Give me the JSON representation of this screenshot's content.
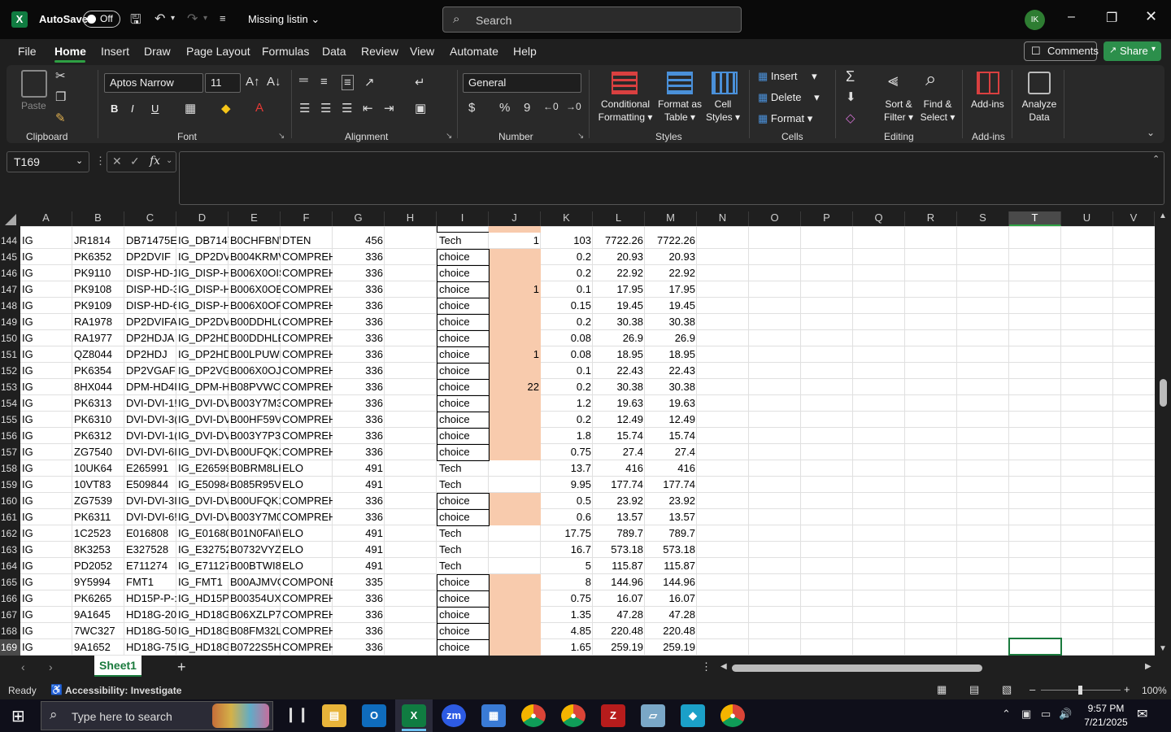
{
  "titlebar": {
    "app_logo": "X",
    "autosave_label": "AutoSave",
    "autosave_state": "Off",
    "document_title": "Missing listin",
    "search_placeholder": "Search",
    "avatar_initials": "IK"
  },
  "menu": [
    "File",
    "Home",
    "Insert",
    "Draw",
    "Page Layout",
    "Formulas",
    "Data",
    "Review",
    "View",
    "Automate",
    "Help"
  ],
  "menu_active": "Home",
  "comments_label": "Comments",
  "share_label": "Share",
  "ribbon": {
    "clipboard": {
      "paste": "Paste",
      "label": "Clipboard"
    },
    "font": {
      "name": "Aptos Narrow",
      "size": "11",
      "label": "Font",
      "bold": "B",
      "italic": "I",
      "underline": "U"
    },
    "alignment": {
      "label": "Alignment"
    },
    "number": {
      "format": "General",
      "label": "Number",
      "currency": "$",
      "percent": "%",
      "comma": "9"
    },
    "styles": {
      "conditional": "Conditional",
      "formatting": "Formatting",
      "format_as": "Format as",
      "table": "Table",
      "cell": "Cell",
      "cell_styles": "Styles",
      "label": "Styles"
    },
    "cells": {
      "insert": "Insert",
      "delete": "Delete",
      "format": "Format",
      "label": "Cells"
    },
    "editing": {
      "sort": "Sort &",
      "filter": "Filter",
      "find": "Find &",
      "select": "Select",
      "label": "Editing"
    },
    "addins": {
      "addins": "Add-ins",
      "label": "Add-ins"
    },
    "analyze": {
      "line1": "Analyze",
      "line2": "Data"
    }
  },
  "formula_bar": {
    "name_box": "T169",
    "fx": "fx",
    "content": ""
  },
  "columns": [
    "A",
    "B",
    "C",
    "D",
    "E",
    "F",
    "G",
    "H",
    "I",
    "J",
    "K",
    "L",
    "M",
    "N",
    "O",
    "P",
    "Q",
    "R",
    "S",
    "T",
    "U",
    "V"
  ],
  "active_column": "T",
  "rows": [
    {
      "n": "144",
      "a": "IG",
      "b": "JR1814",
      "c": "DB71475E",
      "d": "IG_DB7147",
      "e": "B0CHFBN\\",
      "f": "DTEN",
      "g": "456",
      "i": "Tech",
      "j": "1",
      "k": "103",
      "l": "7722.26",
      "m": "7722.26",
      "hl": false
    },
    {
      "n": "145",
      "a": "IG",
      "b": "PK6352",
      "c": "DP2DVIF",
      "d": "IG_DP2DV",
      "e": "B004KRMV",
      "f": "COMPREH",
      "g": "336",
      "i": "choice",
      "j": "",
      "k": "0.2",
      "l": "20.93",
      "m": "20.93",
      "hl": true
    },
    {
      "n": "146",
      "a": "IG",
      "b": "PK9110",
      "c": "DISP-HD-1",
      "d": "IG_DISP-H",
      "e": "B006X0OIS",
      "f": "COMPREH",
      "g": "336",
      "i": "choice",
      "j": "",
      "k": "0.2",
      "l": "22.92",
      "m": "22.92",
      "hl": true
    },
    {
      "n": "147",
      "a": "IG",
      "b": "PK9108",
      "c": "DISP-HD-3",
      "d": "IG_DISP-H",
      "e": "B006X0OB",
      "f": "COMPREH",
      "g": "336",
      "i": "choice",
      "j": "1",
      "k": "0.1",
      "l": "17.95",
      "m": "17.95",
      "hl": true
    },
    {
      "n": "148",
      "a": "IG",
      "b": "PK9109",
      "c": "DISP-HD-6",
      "d": "IG_DISP-H",
      "e": "B006X0OF",
      "f": "COMPREH",
      "g": "336",
      "i": "choice",
      "j": "",
      "k": "0.15",
      "l": "19.45",
      "m": "19.45",
      "hl": true
    },
    {
      "n": "149",
      "a": "IG",
      "b": "RA1978",
      "c": "DP2DVIFA",
      "d": "IG_DP2DV",
      "e": "B00DDHLC",
      "f": "COMPREH",
      "g": "336",
      "i": "choice",
      "j": "",
      "k": "0.2",
      "l": "30.38",
      "m": "30.38",
      "hl": true
    },
    {
      "n": "150",
      "a": "IG",
      "b": "RA1977",
      "c": "DP2HDJA",
      "d": "IG_DP2HD",
      "e": "B00DDHLE",
      "f": "COMPREH",
      "g": "336",
      "i": "choice",
      "j": "",
      "k": "0.08",
      "l": "26.9",
      "m": "26.9",
      "hl": true
    },
    {
      "n": "151",
      "a": "IG",
      "b": "QZ8044",
      "c": "DP2HDJ",
      "d": "IG_DP2HD",
      "e": "B00LPUWE",
      "f": "COMPREH",
      "g": "336",
      "i": "choice",
      "j": "1",
      "k": "0.08",
      "l": "18.95",
      "m": "18.95",
      "hl": true
    },
    {
      "n": "152",
      "a": "IG",
      "b": "PK6354",
      "c": "DP2VGAF",
      "d": "IG_DP2VG.",
      "e": "B006X0OJ'",
      "f": "COMPREH",
      "g": "336",
      "i": "choice",
      "j": "",
      "k": "0.1",
      "l": "22.43",
      "m": "22.43",
      "hl": true
    },
    {
      "n": "153",
      "a": "IG",
      "b": "8HX044",
      "c": "DPM-HD4I",
      "d": "IG_DPM-H",
      "e": "B08PVWCI",
      "f": "COMPREH",
      "g": "336",
      "i": "choice",
      "j": "22",
      "k": "0.2",
      "l": "30.38",
      "m": "30.38",
      "hl": true
    },
    {
      "n": "154",
      "a": "IG",
      "b": "PK6313",
      "c": "DVI-DVI-1!",
      "d": "IG_DVI-DV",
      "e": "B003Y7M3",
      "f": "COMPREH",
      "g": "336",
      "i": "choice",
      "j": "",
      "k": "1.2",
      "l": "19.63",
      "m": "19.63",
      "hl": true
    },
    {
      "n": "155",
      "a": "IG",
      "b": "PK6310",
      "c": "DVI-DVI-3(",
      "d": "IG_DVI-DV",
      "e": "B00HF59V",
      "f": "COMPREH",
      "g": "336",
      "i": "choice",
      "j": "",
      "k": "0.2",
      "l": "12.49",
      "m": "12.49",
      "hl": true
    },
    {
      "n": "156",
      "a": "IG",
      "b": "PK6312",
      "c": "DVI-DVI-1(",
      "d": "IG_DVI-DV",
      "e": "B003Y7P3I",
      "f": "COMPREH",
      "g": "336",
      "i": "choice",
      "j": "",
      "k": "1.8",
      "l": "15.74",
      "m": "15.74",
      "hl": true
    },
    {
      "n": "157",
      "a": "IG",
      "b": "ZG7540",
      "c": "DVI-DVI-6I",
      "d": "IG_DVI-DV",
      "e": "B00UFQK1",
      "f": "COMPREH",
      "g": "336",
      "i": "choice",
      "j": "",
      "k": "0.75",
      "l": "27.4",
      "m": "27.4",
      "hl": true
    },
    {
      "n": "158",
      "a": "IG",
      "b": "10UK64",
      "c": "E265991",
      "d": "IG_E26599",
      "e": "B0BRM8LK",
      "f": "ELO",
      "g": "491",
      "i": "Tech",
      "j": "",
      "k": "13.7",
      "l": "416",
      "m": "416",
      "hl": false
    },
    {
      "n": "159",
      "a": "IG",
      "b": "10VT83",
      "c": "E509844",
      "d": "IG_E50984",
      "e": "B085R95V.",
      "f": "ELO",
      "g": "491",
      "i": "Tech",
      "j": "",
      "k": "9.95",
      "l": "177.74",
      "m": "177.74",
      "hl": false
    },
    {
      "n": "160",
      "a": "IG",
      "b": "ZG7539",
      "c": "DVI-DVI-3I",
      "d": "IG_DVI-DV",
      "e": "B00UFQK1",
      "f": "COMPREH",
      "g": "336",
      "i": "choice",
      "j": "",
      "k": "0.5",
      "l": "23.92",
      "m": "23.92",
      "hl": true
    },
    {
      "n": "161",
      "a": "IG",
      "b": "PK6311",
      "c": "DVI-DVI-6!",
      "d": "IG_DVI-DV",
      "e": "B003Y7M0",
      "f": "COMPREH",
      "g": "336",
      "i": "choice",
      "j": "",
      "k": "0.6",
      "l": "13.57",
      "m": "13.57",
      "hl": true
    },
    {
      "n": "162",
      "a": "IG",
      "b": "1C2523",
      "c": "E016808",
      "d": "IG_E01680",
      "e": "B01N0FAI\\",
      "f": "ELO",
      "g": "491",
      "i": "Tech",
      "j": "",
      "k": "17.75",
      "l": "789.7",
      "m": "789.7",
      "hl": false
    },
    {
      "n": "163",
      "a": "IG",
      "b": "8K3253",
      "c": "E327528",
      "d": "IG_E32752",
      "e": "B0732VYZI",
      "f": "ELO",
      "g": "491",
      "i": "Tech",
      "j": "",
      "k": "16.7",
      "l": "573.18",
      "m": "573.18",
      "hl": false
    },
    {
      "n": "164",
      "a": "IG",
      "b": "PD2052",
      "c": "E711274",
      "d": "IG_E71127",
      "e": "B00BTWI8",
      "f": "ELO",
      "g": "491",
      "i": "Tech",
      "j": "",
      "k": "5",
      "l": "115.87",
      "m": "115.87",
      "hl": false
    },
    {
      "n": "165",
      "a": "IG",
      "b": "9Y5994",
      "c": "FMT1",
      "d": "IG_FMT1",
      "e": "B00AJMVG",
      "f": "COMPONE",
      "g": "335",
      "i": "choice",
      "j": "",
      "k": "8",
      "l": "144.96",
      "m": "144.96",
      "hl": true
    },
    {
      "n": "166",
      "a": "IG",
      "b": "PK6265",
      "c": "HD15P-P-:",
      "d": "IG_HD15P-",
      "e": "B00354UX",
      "f": "COMPREH",
      "g": "336",
      "i": "choice",
      "j": "",
      "k": "0.75",
      "l": "16.07",
      "m": "16.07",
      "hl": true
    },
    {
      "n": "167",
      "a": "IG",
      "b": "9A1645",
      "c": "HD18G-20",
      "d": "IG_HD18G",
      "e": "B06XZLP7I",
      "f": "COMPREH",
      "g": "336",
      "i": "choice",
      "j": "",
      "k": "1.35",
      "l": "47.28",
      "m": "47.28",
      "hl": true
    },
    {
      "n": "168",
      "a": "IG",
      "b": "7WC327",
      "c": "HD18G-50",
      "d": "IG_HD18G",
      "e": "B08FM32L",
      "f": "COMPREH",
      "g": "336",
      "i": "choice",
      "j": "",
      "k": "4.85",
      "l": "220.48",
      "m": "220.48",
      "hl": true
    },
    {
      "n": "169",
      "a": "IG",
      "b": "9A1652",
      "c": "HD18G-75",
      "d": "IG_HD18G",
      "e": "B0722S5H!",
      "f": "COMPREH",
      "g": "336",
      "i": "choice",
      "j": "",
      "k": "1.65",
      "l": "259.19",
      "m": "259.19",
      "hl": true
    }
  ],
  "sheet_tabs": [
    "Sheet1"
  ],
  "status": {
    "ready": "Ready",
    "accessibility": "Accessibility: Investigate",
    "zoom": "100%"
  },
  "taskbar": {
    "search_placeholder": "Type here to search",
    "time": "9:57 PM",
    "date": "7/21/2025"
  },
  "colors": {
    "excel_green": "#107c41",
    "highlight": "#f8cbad",
    "share_green": "#2c8f4b"
  }
}
